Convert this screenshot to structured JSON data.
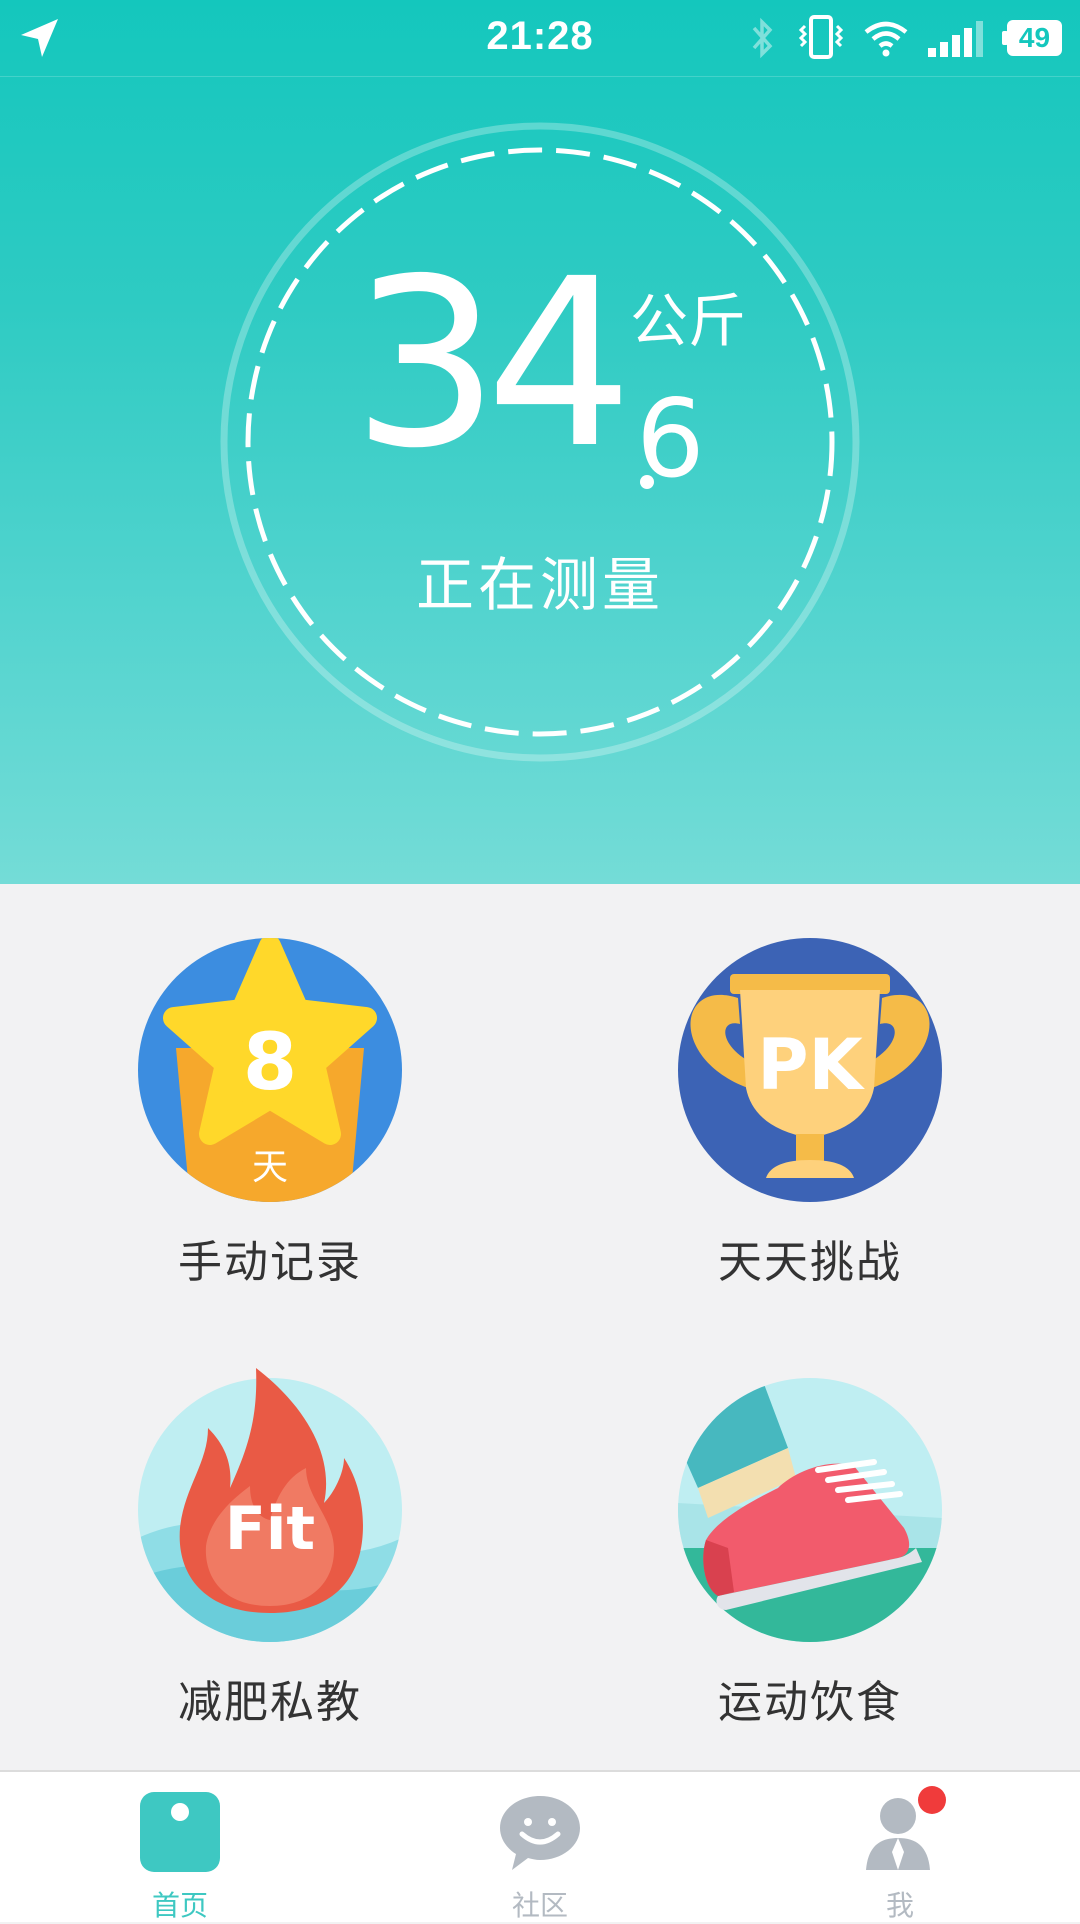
{
  "status_bar": {
    "time": "21:28",
    "battery": "49",
    "icons": [
      "location-arrow-icon",
      "bluetooth-icon",
      "vibrate-icon",
      "wifi-icon",
      "signal-icon",
      "battery-icon"
    ]
  },
  "weight": {
    "integer": "34",
    "decimal": "6",
    "unit": "公斤",
    "status": "正在测量"
  },
  "features": [
    {
      "label": "手动记录",
      "badge_number": "8",
      "badge_unit": "天",
      "icon": "star-badge-icon"
    },
    {
      "label": "天天挑战",
      "badge_text": "PK",
      "icon": "trophy-icon"
    },
    {
      "label": "减肥私教",
      "badge_text": "Fit",
      "icon": "flame-icon"
    },
    {
      "label": "运动饮食",
      "icon": "sneaker-icon"
    }
  ],
  "nav": {
    "items": [
      {
        "label": "首页",
        "icon": "home-scale-icon",
        "active": true
      },
      {
        "label": "社区",
        "icon": "chat-bubble-icon",
        "active": false
      },
      {
        "label": "我",
        "icon": "profile-icon",
        "active": false,
        "has_notification": true
      }
    ]
  },
  "colors": {
    "accent": "#3ec8c2",
    "hero_top": "#14c7bd",
    "hero_bottom": "#74dcd7",
    "nav_inactive": "#b3bac2",
    "notification": "#f03b3b"
  }
}
